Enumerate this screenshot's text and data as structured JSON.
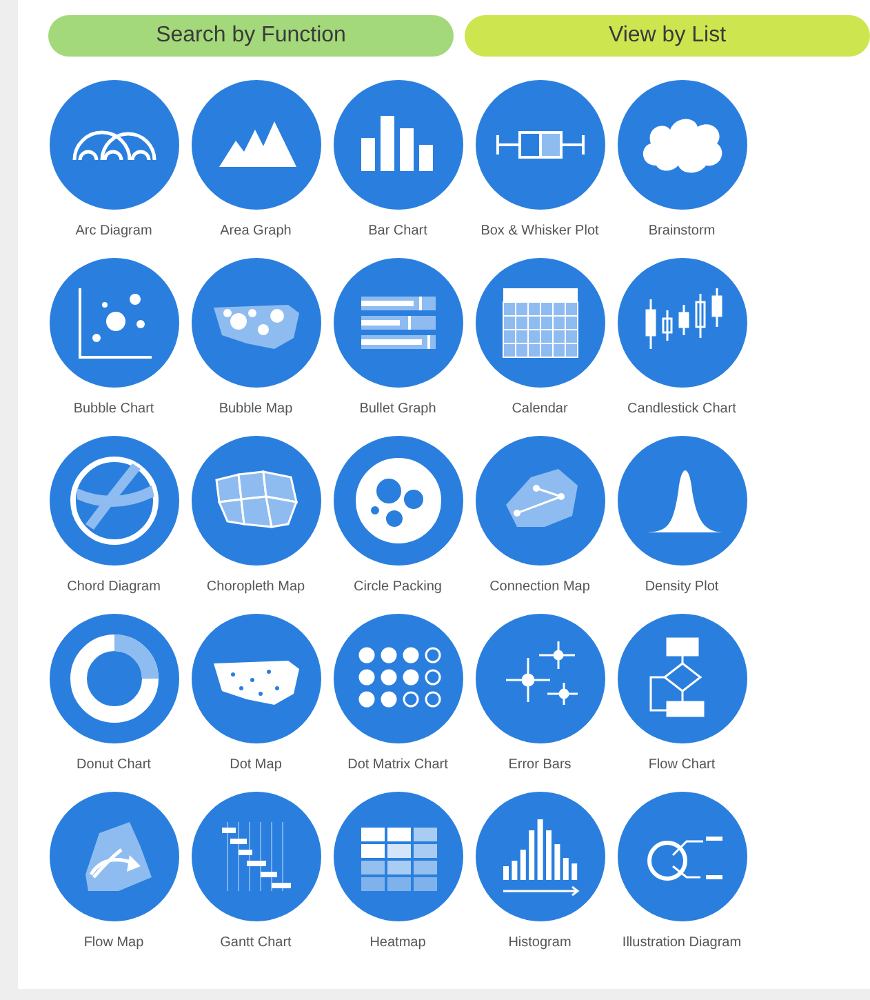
{
  "buttons": [
    {
      "label": "Search by Function",
      "kind": "function"
    },
    {
      "label": "View by List",
      "kind": "list"
    }
  ],
  "charts": [
    {
      "label": "Arc Diagram"
    },
    {
      "label": "Area Graph"
    },
    {
      "label": "Bar Chart"
    },
    {
      "label": "Box & Whisker Plot"
    },
    {
      "label": "Brainstorm"
    },
    {
      "label": "Bubble Chart"
    },
    {
      "label": "Bubble Map"
    },
    {
      "label": "Bullet Graph"
    },
    {
      "label": "Calendar"
    },
    {
      "label": "Candlestick Chart"
    },
    {
      "label": "Chord Diagram"
    },
    {
      "label": "Choropleth Map"
    },
    {
      "label": "Circle Packing"
    },
    {
      "label": "Connection Map"
    },
    {
      "label": "Density Plot"
    },
    {
      "label": "Donut Chart"
    },
    {
      "label": "Dot Map"
    },
    {
      "label": "Dot Matrix Chart"
    },
    {
      "label": "Error Bars"
    },
    {
      "label": "Flow Chart"
    },
    {
      "label": "Flow Map"
    },
    {
      "label": "Gantt Chart"
    },
    {
      "label": "Heatmap"
    },
    {
      "label": "Histogram"
    },
    {
      "label": "Illustration Diagram"
    }
  ]
}
